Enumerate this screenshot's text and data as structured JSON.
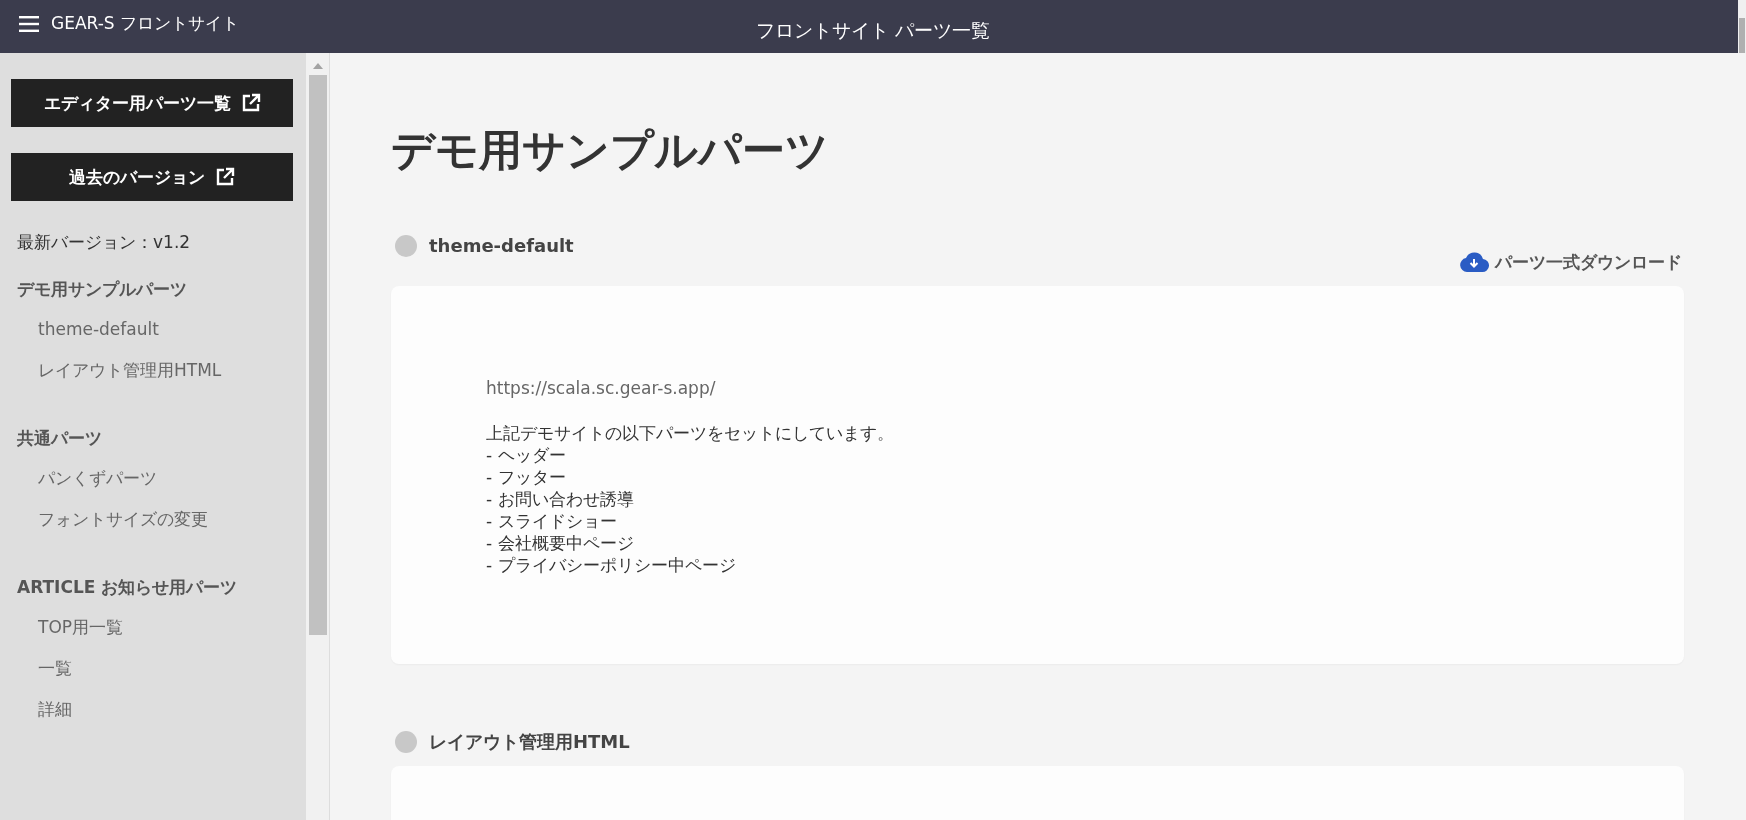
{
  "header": {
    "site_title": "GEAR-S フロントサイト",
    "page_title": "フロントサイト パーツ一覧"
  },
  "sidebar": {
    "buttons": [
      "エディター用パーツ一覧",
      "過去のバージョン"
    ],
    "version": "最新バージョン：v1.2",
    "groups": [
      {
        "title": "デモ用サンプルパーツ",
        "items": [
          "theme-default",
          "レイアウト管理用HTML"
        ]
      },
      {
        "title": "共通パーツ",
        "items": [
          "パンくずパーツ",
          "フォントサイズの変更"
        ]
      },
      {
        "title": "ARTICLE お知らせ用パーツ",
        "items": [
          "TOP用一覧",
          "一覧",
          "詳細"
        ]
      }
    ]
  },
  "main": {
    "heading": "デモ用サンプルパーツ",
    "sections": [
      {
        "title": "theme-default",
        "download": "パーツ一式ダウンロード",
        "url": "https://scala.sc.gear-s.app/",
        "description": "上記デモサイトの以下パーツをセットにしています。",
        "lines": [
          "- ヘッダー",
          "- フッター",
          "- お問い合わせ誘導",
          "- スライドショー",
          "- 会社概要中ページ",
          "- プライバシーポリシー中ページ"
        ]
      },
      {
        "title": "レイアウト管理用HTML"
      }
    ]
  }
}
